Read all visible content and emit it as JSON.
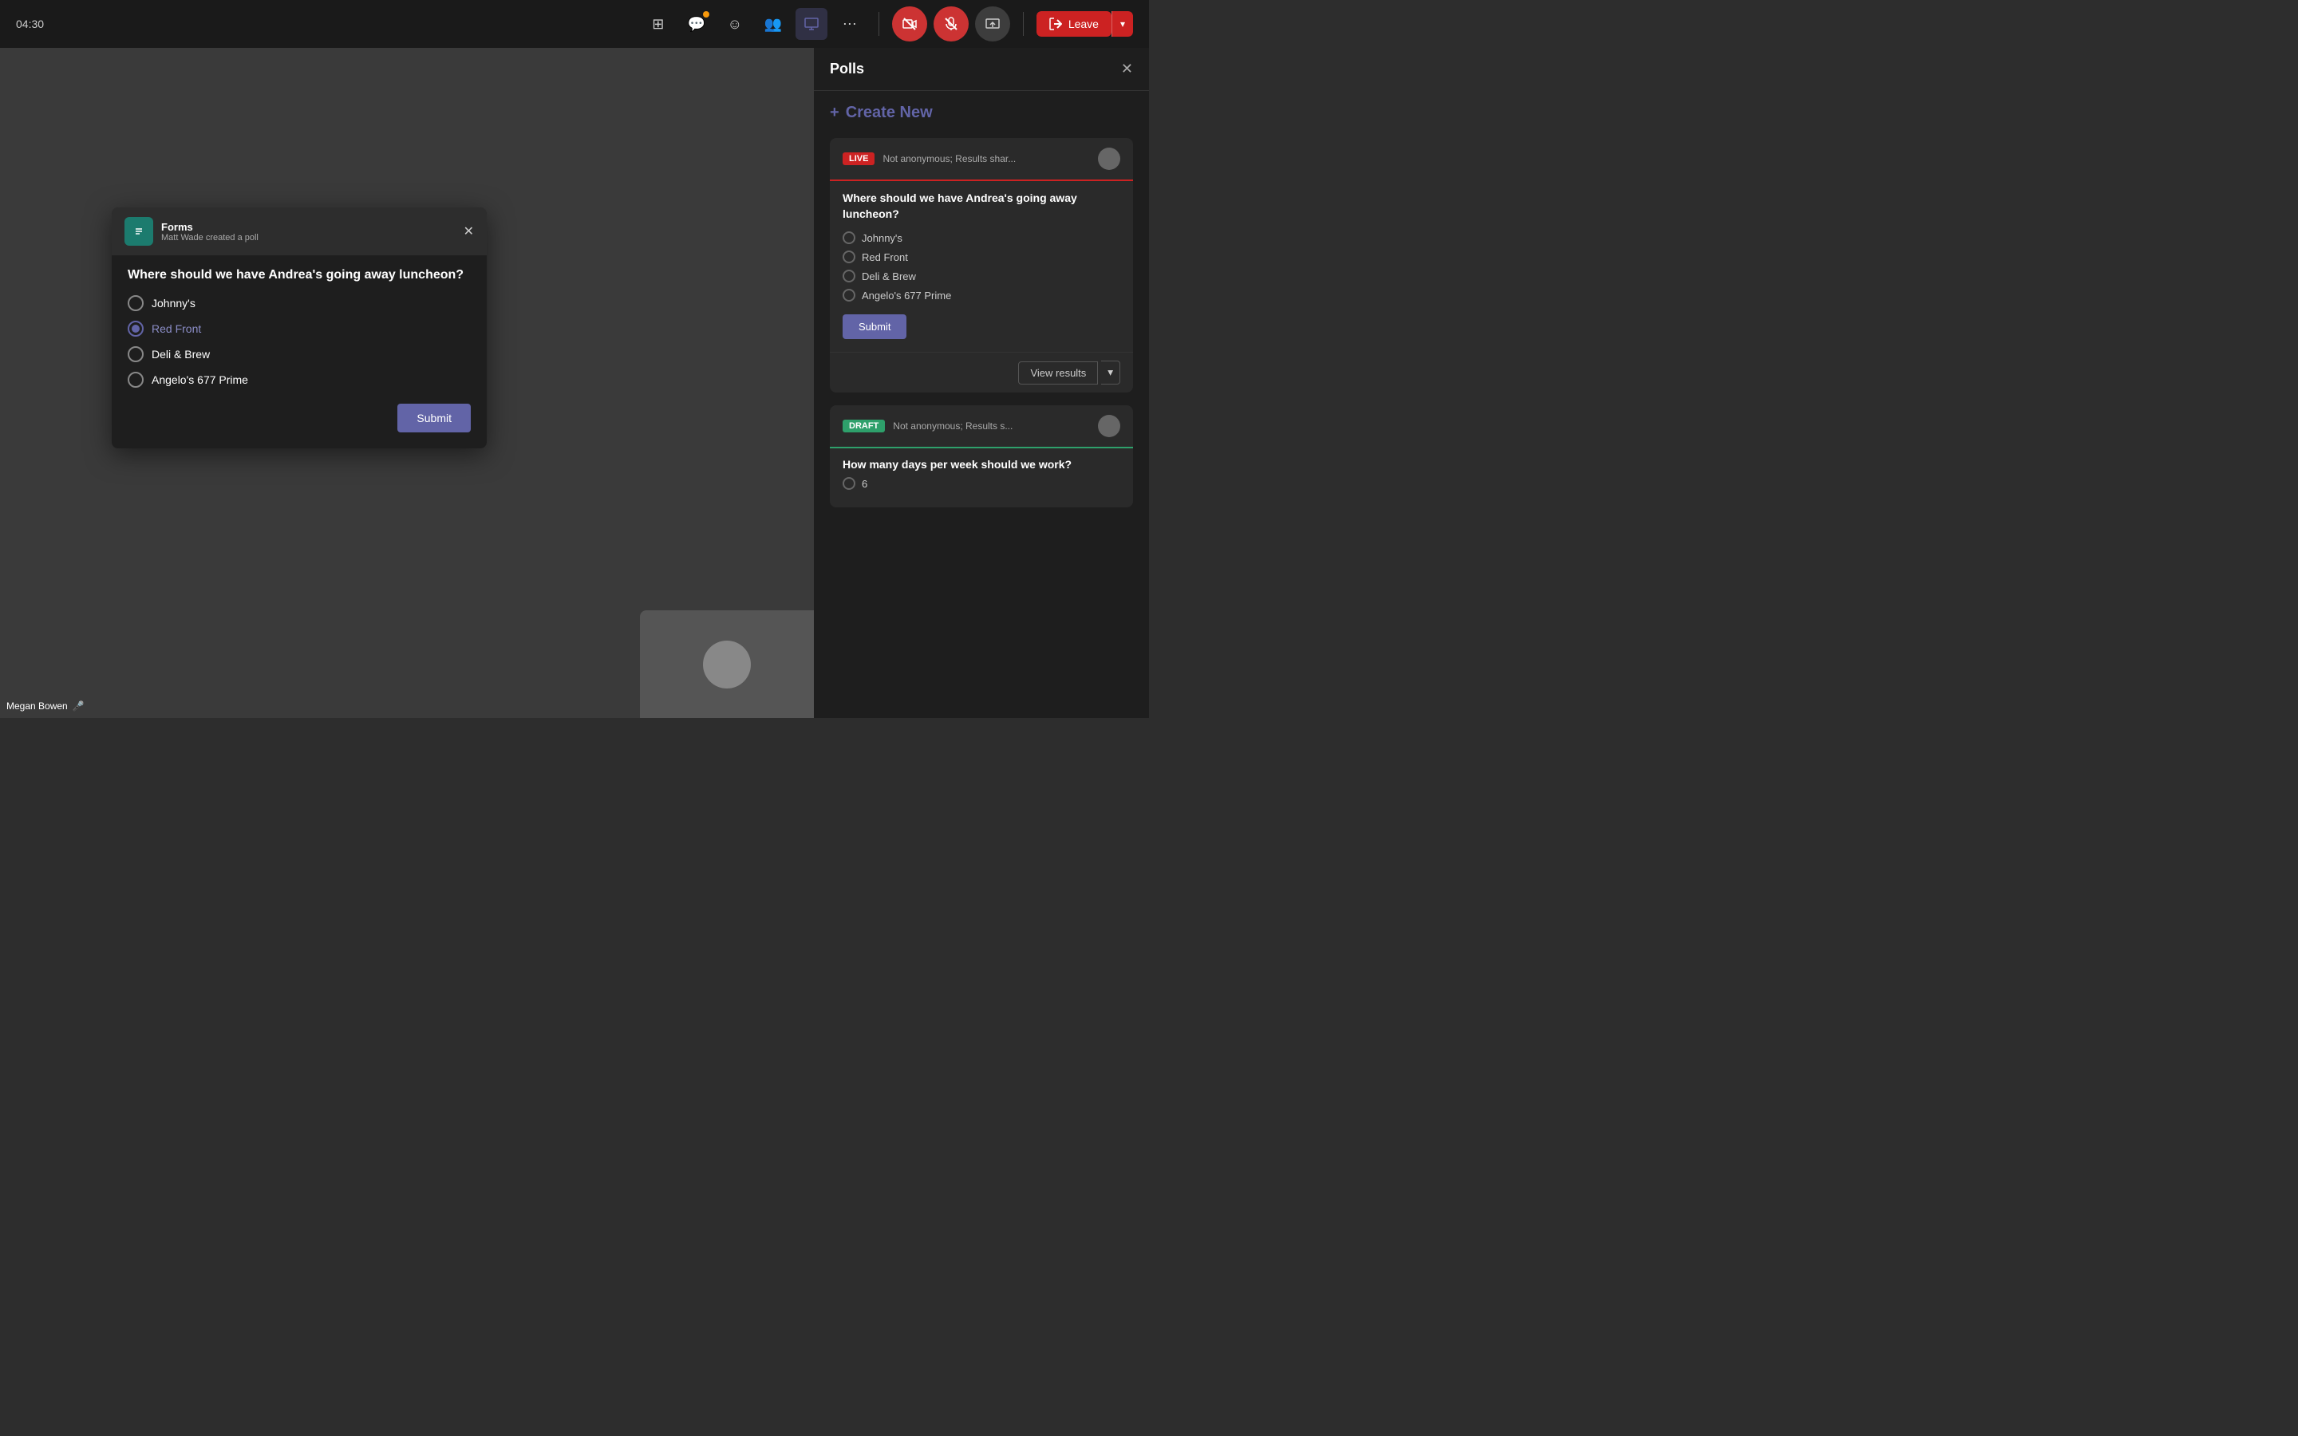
{
  "topbar": {
    "time": "04:30",
    "leave_label": "Leave",
    "icons": [
      {
        "name": "grid-icon",
        "symbol": "⊞",
        "active": false,
        "badge": false
      },
      {
        "name": "chat-icon",
        "symbol": "💬",
        "active": false,
        "badge": true
      },
      {
        "name": "emoji-icon",
        "symbol": "☺",
        "active": false,
        "badge": false
      },
      {
        "name": "people-icon",
        "symbol": "👥",
        "active": false,
        "badge": false
      },
      {
        "name": "present-icon",
        "symbol": "⬛",
        "active": true,
        "badge": false
      },
      {
        "name": "more-icon",
        "symbol": "⋯",
        "active": false,
        "badge": false
      }
    ],
    "media": [
      {
        "name": "camera-off-icon",
        "symbol": "🎥",
        "muted": true
      },
      {
        "name": "mic-off-icon",
        "symbol": "🎤",
        "muted": true
      },
      {
        "name": "share-icon",
        "symbol": "↑",
        "muted": false
      }
    ]
  },
  "poll_popup": {
    "app_name": "Forms",
    "creator": "Matt Wade created a poll",
    "question": "Where should we have Andrea's going away luncheon?",
    "options": [
      {
        "label": "Johnny's",
        "selected": false
      },
      {
        "label": "Red Front",
        "selected": true
      },
      {
        "label": "Deli & Brew",
        "selected": false
      },
      {
        "label": "Angelo's 677 Prime",
        "selected": false
      }
    ],
    "submit_label": "Submit"
  },
  "side_panel": {
    "title": "Polls",
    "create_new_label": "Create New",
    "polls": [
      {
        "status": "LIVE",
        "meta": "Not anonymous; Results shar...",
        "question": "Where should we have Andrea's going away luncheon?",
        "options": [
          {
            "label": "Johnny's"
          },
          {
            "label": "Red Front"
          },
          {
            "label": "Deli & Brew"
          },
          {
            "label": "Angelo's 677 Prime"
          }
        ],
        "submit_label": "Submit",
        "view_results_label": "View results"
      },
      {
        "status": "DRAFT",
        "meta": "Not anonymous; Results s...",
        "question": "How many days per week should we work?",
        "options": [
          {
            "label": "6"
          }
        ]
      }
    ]
  },
  "meeting": {
    "participant_name": "Megan Bowen"
  }
}
